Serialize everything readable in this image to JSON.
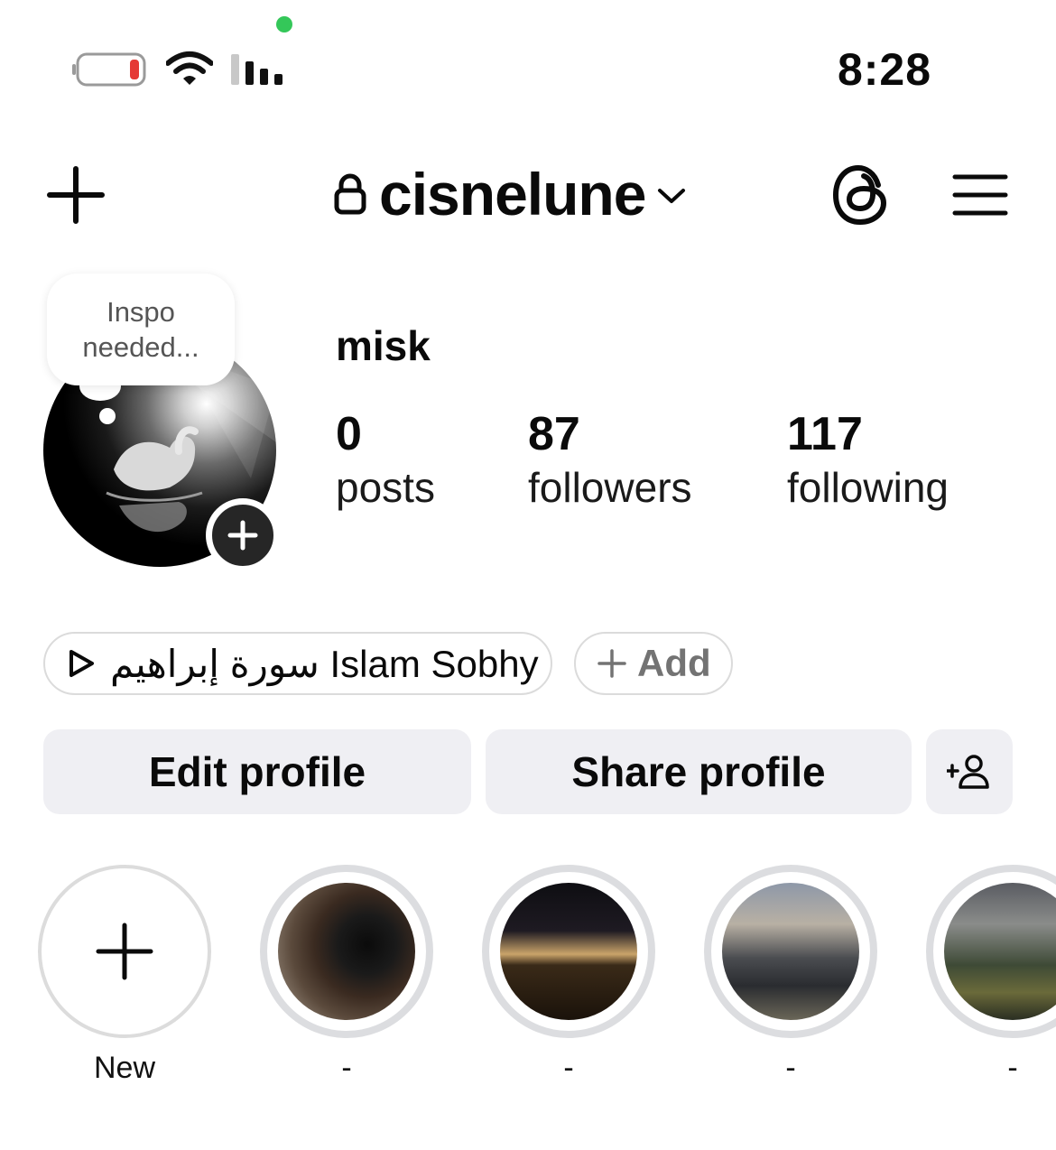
{
  "status_bar": {
    "time": "8:28",
    "battery_color": "#e53935",
    "privacy_dot_color": "#34c759"
  },
  "header": {
    "username": "cisnelune"
  },
  "profile": {
    "note": "Inspo needed...",
    "display_name": "misk",
    "stats": [
      {
        "value": "0",
        "label": "posts"
      },
      {
        "value": "87",
        "label": "followers"
      },
      {
        "value": "117",
        "label": "following"
      }
    ],
    "music": "سورة إبراهيم Islam Sobhy",
    "add_label": "Add"
  },
  "actions": {
    "edit": "Edit profile",
    "share": "Share profile"
  },
  "highlights": [
    {
      "label": "New"
    },
    {
      "label": "-"
    },
    {
      "label": "-"
    },
    {
      "label": "-"
    },
    {
      "label": "-"
    }
  ]
}
